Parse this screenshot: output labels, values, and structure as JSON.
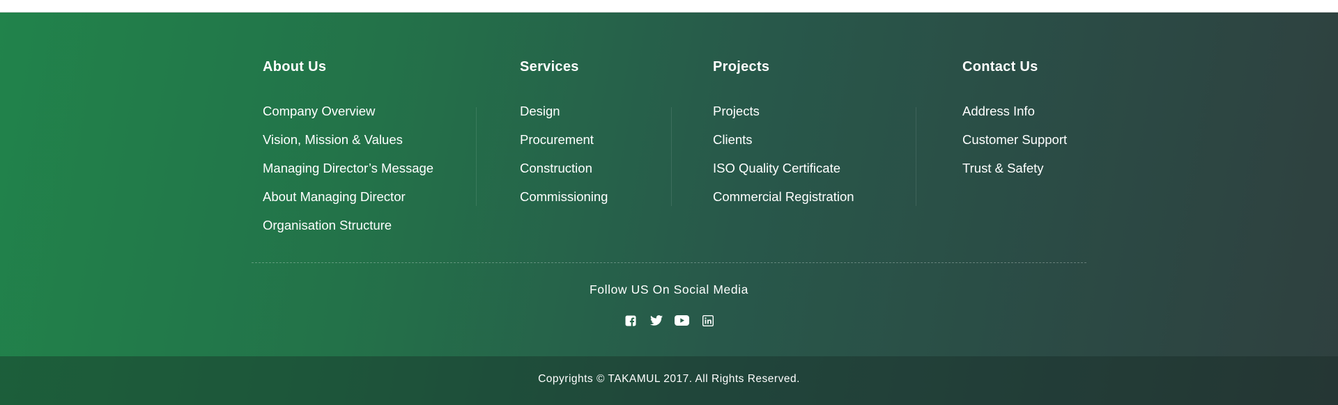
{
  "columns": [
    {
      "title": "About Us",
      "links": [
        "Company Overview",
        "Vision, Mission & Values",
        "Managing Director’s Message",
        "About Managing Director",
        "Organisation Structure"
      ]
    },
    {
      "title": "Services",
      "links": [
        "Design",
        "Procurement",
        "Construction",
        "Commissioning"
      ]
    },
    {
      "title": "Projects",
      "links": [
        "Projects",
        "Clients",
        "ISO Quality Certificate",
        "Commercial Registration"
      ]
    },
    {
      "title": "Contact Us",
      "links": [
        "Address Info",
        "Customer Support",
        "Trust & Safety"
      ]
    }
  ],
  "social": {
    "title": "Follow US On Social Media",
    "icons": [
      "facebook-icon",
      "twitter-icon",
      "youtube-icon",
      "linkedin-icon"
    ]
  },
  "copyright": "Copyrights © TAKAMUL 2017. All Rights Reserved.",
  "colors": {
    "gradient_start": "#21834b",
    "gradient_end": "#2f403f",
    "text": "#ffffff"
  }
}
